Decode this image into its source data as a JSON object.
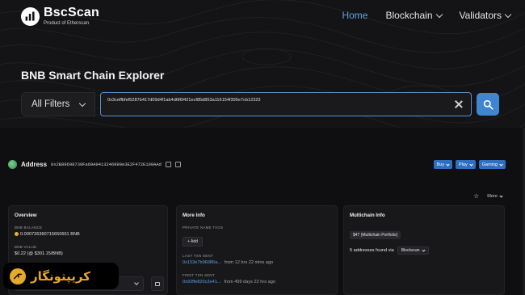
{
  "brand": {
    "title": "BscScan",
    "subtitle": "Product of Etherscan"
  },
  "nav": {
    "items": [
      {
        "label": "Home",
        "active": true,
        "dropdown": false
      },
      {
        "label": "Blockchain",
        "active": false,
        "dropdown": true
      },
      {
        "label": "Validators",
        "active": false,
        "dropdown": true
      }
    ]
  },
  "hero": {
    "title": "BNB Smart Chain Explorer"
  },
  "search": {
    "filter_label": "All Filters",
    "query": "0x3ceffbfef5287b417d09d4f1ab4d6f6f421ecf85d853a116154f395e7cb12323",
    "clear_icon": "close-icon",
    "submit_icon": "search-icon"
  },
  "address": {
    "label": "Address",
    "hash": "0x2B89698739Fa69A9413246990e3E2F472E109AAd"
  },
  "actions": {
    "buy": "Buy",
    "play": "Play",
    "gaming": "Gaming",
    "more": "More"
  },
  "overview": {
    "title": "Overview",
    "balance_label": "BNB BALANCE",
    "balance_value": "0.000726360715650651 BNB",
    "value_label": "BNB VALUE",
    "value_value": "$0.22 (@ $301.15/BNB)"
  },
  "more_info": {
    "title": "More Info",
    "tags_label": "PRIVATE NAME TAGS",
    "add_label": "+ Add",
    "last_label": "LAST TXN SENT",
    "last_hash": "0x153e7b96086a...",
    "last_time": "from 12 hrs 22 mins ago",
    "first_label": "FIRST TXN SENT",
    "first_hash": "0x92ffe820c2e41...",
    "first_time": "from 499 days 22 hrs ago"
  },
  "multichain": {
    "title": "Multichain Info",
    "portfolio": "$47 (Multichain Portfolio)",
    "found_text": "5 addresses found via",
    "source": "Blockscan"
  },
  "watermark": {
    "text": "کریپتونگار"
  },
  "colors": {
    "accent": "#3f85d2",
    "link": "#5a9fe6",
    "watermark": "#e9a728"
  }
}
